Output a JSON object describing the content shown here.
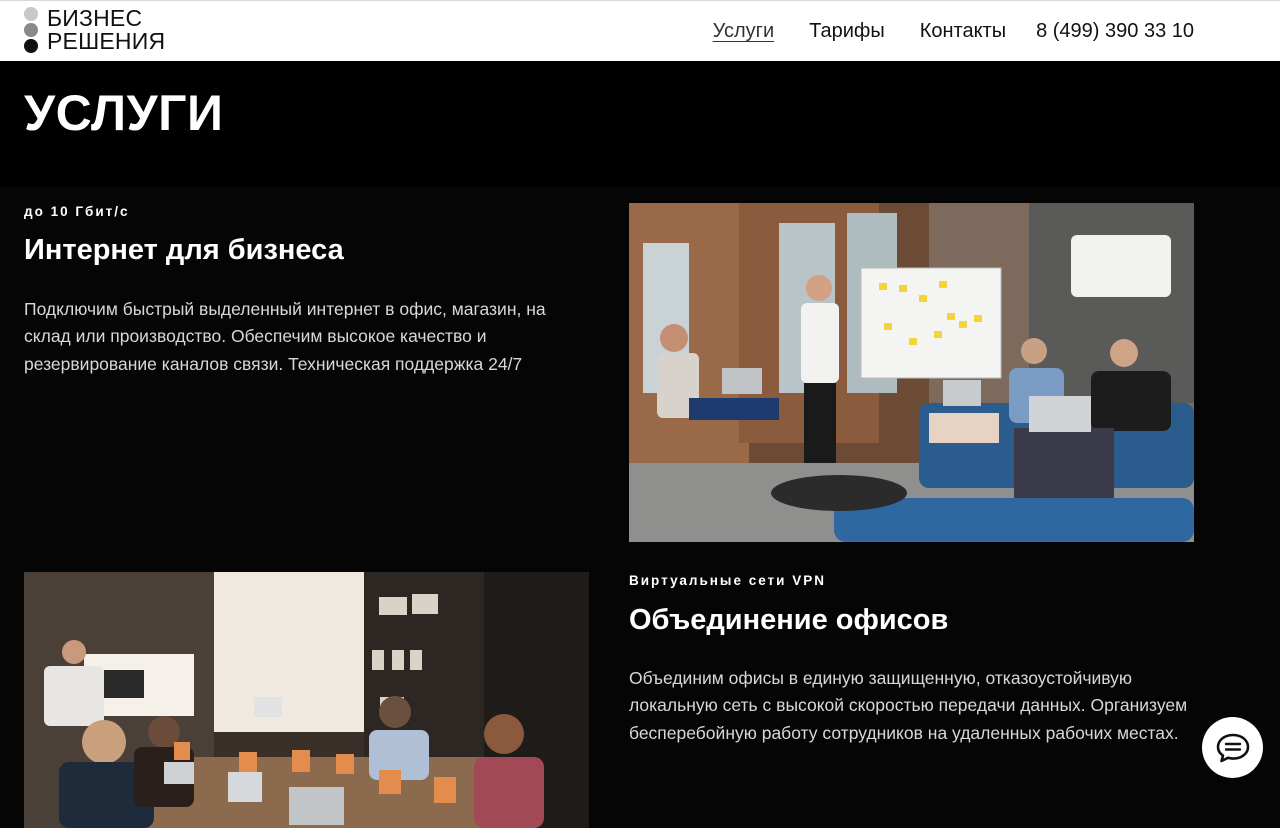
{
  "header": {
    "logo": {
      "line1": "БИЗНЕС",
      "line2": "РЕШЕНИЯ"
    },
    "nav": [
      {
        "label": "Услуги",
        "active": true
      },
      {
        "label": "Тарифы",
        "active": false
      },
      {
        "label": "Контакты",
        "active": false
      }
    ],
    "phone": "8 (499) 390 33 10"
  },
  "page": {
    "title": "УСЛУГИ"
  },
  "services": [
    {
      "eyebrow": "до 10 Гбит/с",
      "title": "Интернет для бизнеса",
      "description": "Подключим быстрый выделенный интернет в офис, магазин, на склад или производство. Обеспечим высокое качество и резервирование каналов связи. Техническая поддержка 24/7",
      "image": "office-team-meeting-whiteboard-photo"
    },
    {
      "eyebrow": "Виртуальные сети VPN",
      "title": "Объединение офисов",
      "description": "Объединим офисы в единую защищенную, отказоустойчивую локальную сеть с высокой скоростью передачи данных. Организуем бесперебойную работу сотрудников на удаленных рабочих местах.",
      "image": "conference-room-presentation-photo"
    }
  ],
  "chat": {
    "icon": "chat-bubble-icon"
  },
  "colors": {
    "background": "#000000",
    "header": "#ffffff",
    "text": "#ffffff",
    "muted_text": "#d8d8d8"
  }
}
